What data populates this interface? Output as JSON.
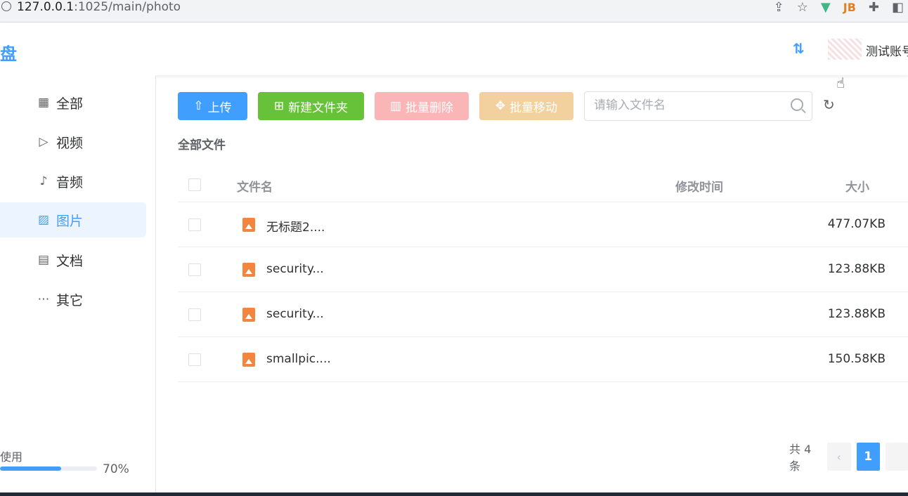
{
  "browser": {
    "url_host": "127.0.0.1",
    "url_path": ":1025/main/photo",
    "icons": [
      "share-icon",
      "star-icon",
      "vue-devtools-icon",
      "jb-icon",
      "extensions-icon",
      "sidepanel-icon"
    ]
  },
  "header": {
    "logo": "盘",
    "transfer_icon": "⇅",
    "username": "测试账号"
  },
  "sidebar": {
    "items": [
      {
        "label": "全部",
        "icon": "grid-icon"
      },
      {
        "label": "视频",
        "icon": "video-icon"
      },
      {
        "label": "音频",
        "icon": "mic-icon"
      },
      {
        "label": "图片",
        "icon": "image-icon"
      },
      {
        "label": "文档",
        "icon": "document-icon"
      },
      {
        "label": "其它",
        "icon": "more-icon"
      }
    ],
    "active_index": 3,
    "storage": {
      "label": "使用",
      "percent_text": "70%",
      "percent": 70
    }
  },
  "toolbar": {
    "upload": "上传",
    "new_folder": "新建文件夹",
    "batch_delete": "批量删除",
    "batch_move": "批量移动",
    "search_placeholder": "请输入文件名"
  },
  "breadcrumb": "全部文件",
  "table": {
    "headers": {
      "name": "文件名",
      "modified": "修改时间",
      "size": "大小"
    },
    "rows": [
      {
        "name": "无标题2....",
        "size": "477.07KB"
      },
      {
        "name": "security...",
        "size": "123.88KB"
      },
      {
        "name": "security...",
        "size": "123.88KB"
      },
      {
        "name": "smallpic....",
        "size": "150.58KB"
      }
    ]
  },
  "pagination": {
    "total": "共 4 条",
    "prev": "‹",
    "current": "1"
  },
  "colors": {
    "primary": "#409eff",
    "success": "#67c23a",
    "danger_light": "#fab6b6",
    "warning_light": "#f3d19e",
    "file_icon": "#f3853c"
  }
}
